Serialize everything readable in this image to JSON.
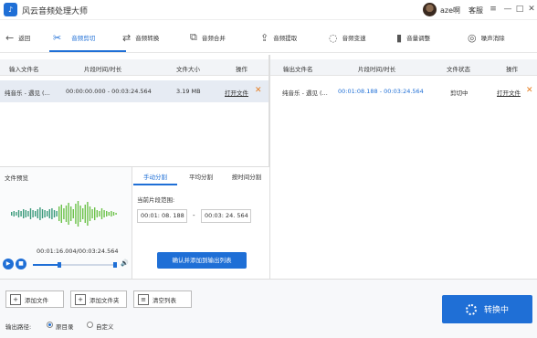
{
  "app": {
    "title": "风云音频处理大师",
    "logo_glyph": "♪"
  },
  "user": {
    "name": "aze啊",
    "support": "客服"
  },
  "window": {
    "menu_glyph": "≡",
    "min_glyph": "—",
    "max_glyph": "□",
    "close_glyph": "✕"
  },
  "toolbar": {
    "back": "返回",
    "items": [
      {
        "label": "音频剪切",
        "icon": "scissors-icon",
        "glyph": "✂"
      },
      {
        "label": "音频转换",
        "icon": "convert-icon",
        "glyph": "⇄"
      },
      {
        "label": "音频合并",
        "icon": "merge-icon",
        "glyph": "⧉"
      },
      {
        "label": "音频提取",
        "icon": "extract-icon",
        "glyph": "⇪"
      },
      {
        "label": "音频变速",
        "icon": "speed-icon",
        "glyph": "◌"
      },
      {
        "label": "音量调整",
        "icon": "volume-bars-icon",
        "glyph": "▮"
      },
      {
        "label": "噪声消除",
        "icon": "noise-icon",
        "glyph": "◎"
      }
    ],
    "active_index": 0
  },
  "input_table": {
    "headers": [
      "输入文件名",
      "片段时间/时长",
      "文件大小",
      "操作"
    ],
    "rows": [
      {
        "name": "纯音乐 - 遇见 (...",
        "time": "00:00:00.000 - 00:03:24.564",
        "size": "3.19 MB",
        "action": "打开文件",
        "delete": "✕"
      }
    ]
  },
  "output_table": {
    "headers": [
      "输出文件名",
      "片段时间/时长",
      "文件状态",
      "操作"
    ],
    "rows": [
      {
        "name": "纯音乐 - 遇见 (...",
        "time": "00:01:08.188 - 00:03:24.564",
        "status": "剪切中",
        "action": "打开文件",
        "delete": "✕"
      }
    ]
  },
  "preview": {
    "label": "文件预览",
    "current_time": "00:01:16.004/00:03:24.564",
    "play_glyph": "▶",
    "stop_glyph": "■",
    "volume_glyph": "🔊"
  },
  "segment": {
    "tabs": [
      "手动分割",
      "平均分割",
      "按时间分割"
    ],
    "active_tab": 0,
    "range_label": "当前片段范围:",
    "start": "00:01: 08. 188",
    "separator": "-",
    "end": "00:03: 24. 564",
    "confirm_button": "确认并添加到输出列表"
  },
  "bottom": {
    "add_file": "添加文件",
    "add_folder": "添加文件夹",
    "clear_list": "清空列表",
    "output_path_label": "输出路径:",
    "options": [
      "原目录",
      "自定义"
    ],
    "selected_option": 0,
    "convert_button": "转换中"
  },
  "colors": {
    "accent": "#1f6fd6",
    "delete": "#e67e22",
    "wave_green": "#6cc24a"
  }
}
